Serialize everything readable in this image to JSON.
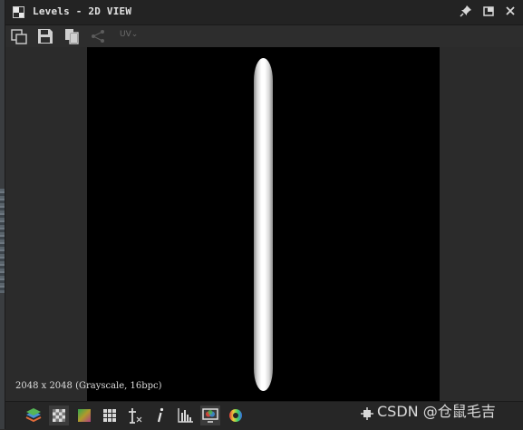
{
  "window": {
    "title": "Levels - 2D VIEW"
  },
  "toolbar": {
    "uv_label": "UV"
  },
  "viewport": {
    "info": "2048 x 2048 (Grayscale, 16bpc)"
  },
  "watermark": {
    "text": "CSDN @仓鼠毛吉"
  },
  "icons": {
    "title": "window-grid-icon",
    "pin": "pin-icon",
    "maximize": "maximize-icon",
    "close": "close-icon",
    "export": "export-icon",
    "save": "save-icon",
    "copy": "copy-icon",
    "share": "share-icon",
    "layers": "layers-icon",
    "transparency": "checkerboard-icon",
    "gradient": "color-gradient-icon",
    "tiling": "tiling-grid-icon",
    "pixel_coords": "pixel-coordinates-icon",
    "info": "info-icon",
    "histogram": "histogram-icon",
    "display": "display-settings-icon",
    "color_wheel": "color-wheel-icon"
  },
  "colors": {
    "background": "#2b2b2b",
    "canvas": "#000000",
    "titlebar": "#232323"
  }
}
